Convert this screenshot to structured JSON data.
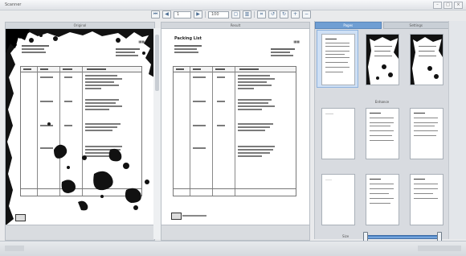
{
  "window": {
    "title": "Scanner",
    "controls": [
      "–",
      "□",
      "×"
    ]
  },
  "toolbar": {
    "buttons": [
      {
        "name": "page-first-icon",
        "glyph": "⏮"
      },
      {
        "name": "page-prev-icon",
        "glyph": "◀"
      },
      {
        "name": "page-next-icon",
        "glyph": "▶"
      },
      {
        "name": "single-view-icon",
        "glyph": "▢"
      },
      {
        "name": "double-view-icon",
        "glyph": "▥"
      },
      {
        "name": "crop-icon",
        "glyph": "⌗"
      },
      {
        "name": "rotate-left-icon",
        "glyph": "↺"
      },
      {
        "name": "rotate-right-icon",
        "glyph": "↻"
      },
      {
        "name": "zoom-in-icon",
        "glyph": "+"
      },
      {
        "name": "zoom-out-icon",
        "glyph": "−"
      }
    ],
    "page_value": "1",
    "zoom_value": "100"
  },
  "panes": {
    "left_header": "Original",
    "right_header": "Result"
  },
  "document": {
    "title": "Packing List"
  },
  "sidebar": {
    "tabs": [
      {
        "label": "Pages",
        "active": true
      },
      {
        "label": "Settings",
        "active": false
      }
    ],
    "row_labels": [
      "",
      "Enhance",
      ""
    ]
  },
  "zoom": {
    "label": "Size",
    "min_label": "-",
    "max_label": "+",
    "level_fraction": 0.98
  },
  "colors": {
    "accent": "#4f86c6",
    "selection": "#cfe0f5"
  }
}
